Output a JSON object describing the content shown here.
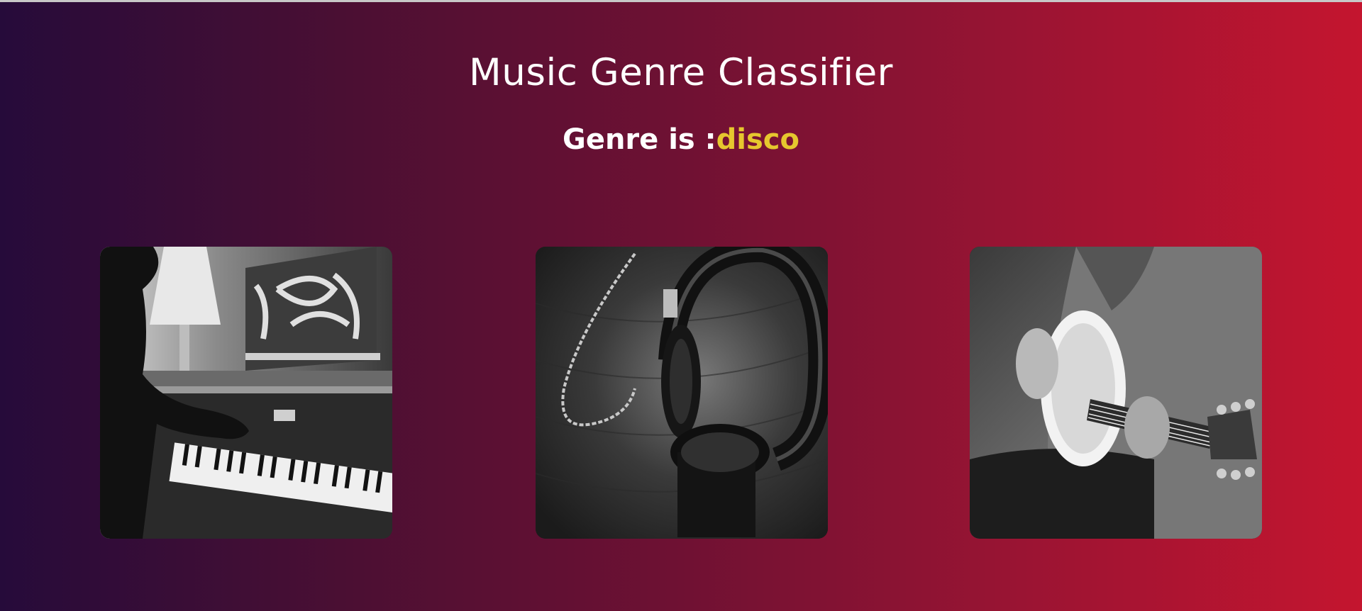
{
  "header": {
    "title": "Music Genre Classifier",
    "result_prefix": "Genre is :",
    "result_value": "disco"
  },
  "colors": {
    "gradient_start": "#260b3a",
    "gradient_end": "#c4152f",
    "genre_value": "#e6c72e",
    "text": "#ffffff"
  },
  "images": [
    {
      "icon": "piano-photo"
    },
    {
      "icon": "headphones-photo"
    },
    {
      "icon": "guitar-photo"
    }
  ]
}
